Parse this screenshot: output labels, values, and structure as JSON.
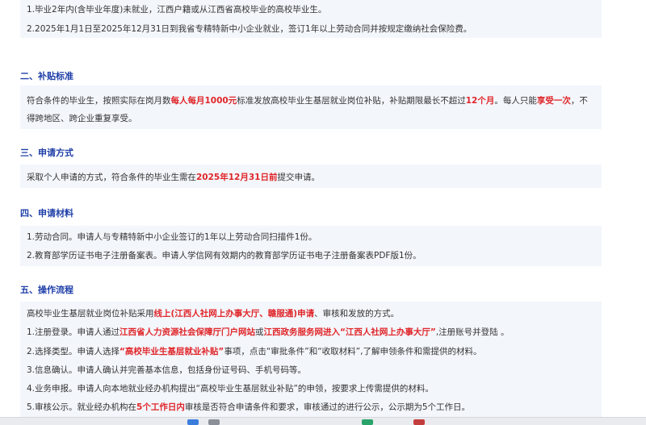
{
  "section1": {
    "line1": "1.毕业2年内(含毕业年度)未就业，江西户籍或从江西省高校毕业的高校毕业生。",
    "line2": "2.2025年1月1日至2025年12月31日到我省专精特新中小企业就业，签订1年以上劳动合同并按规定缴纳社会保险费。"
  },
  "section2": {
    "title": "二、补贴标准",
    "p1_a": "符合条件的毕业生，按照实际在岗月数",
    "p1_b": "每人每月1000元",
    "p1_c": "标准发放高校毕业生基层就业岗位补贴，补贴期限最长不超过",
    "p1_d": "12个月",
    "p1_e": "。每人只能",
    "p1_f": "享受一次",
    "p1_g": "，不",
    "p2": "得跨地区、跨企业重复享受。"
  },
  "section3": {
    "title": "三、申请方式",
    "a": "采取个人申请的方式，符合条件的毕业生需在",
    "b": "2025年12月31日前",
    "c": "提交申请。"
  },
  "section4": {
    "title": "四、申请材料",
    "line1": "1.劳动合同。申请人与专精特新中小企业签订的1年以上劳动合同扫描件1份。",
    "line2": "2.教育部学历证书电子注册备案表。申请人学信网有效期内的教育部学历证书电子注册备案表PDF版1份。"
  },
  "section5": {
    "title": "五、操作流程",
    "intro_a": "高校毕业生基层就业岗位补贴采用",
    "intro_b": "线上(江西人社网上办事大厅、赣服通)申请",
    "intro_c": "、审核和发放的方式。",
    "s1_a": "1.注册登录。申请人通过",
    "s1_b": "江西省人力资源社会保障厅门户网站",
    "s1_c": "或",
    "s1_d": "江西政务服务网进入“江西人社网上办事大厅”",
    "s1_e": ",注册账号并登陆 。",
    "s2_a": "2.选择类型。申请人选择",
    "s2_b": "“高校毕业生基层就业补贴”",
    "s2_c": "事项，点击“审批条件”和“收取材料”,了解申领条件和需提供的材料。",
    "s3": "3.信息确认。申请人确认并完善基本信息，包括身份证号码、手机号码等。",
    "s4": "4.业务申报。申请人向本地就业经办机构提出“高校毕业生基层就业补贴”的申领，按要求上传需提供的材料。",
    "s5_a": "5.审核公示。就业经办机构在",
    "s5_b": "5个工作日内",
    "s5_c": "审核是否符合申请条件和要求，审核通过的进行公示，公示期为5个工作日。"
  },
  "colors": {
    "heading": "#1f3fa8",
    "highlight": "#e0262a",
    "box_bg": "#f3f6fb"
  }
}
